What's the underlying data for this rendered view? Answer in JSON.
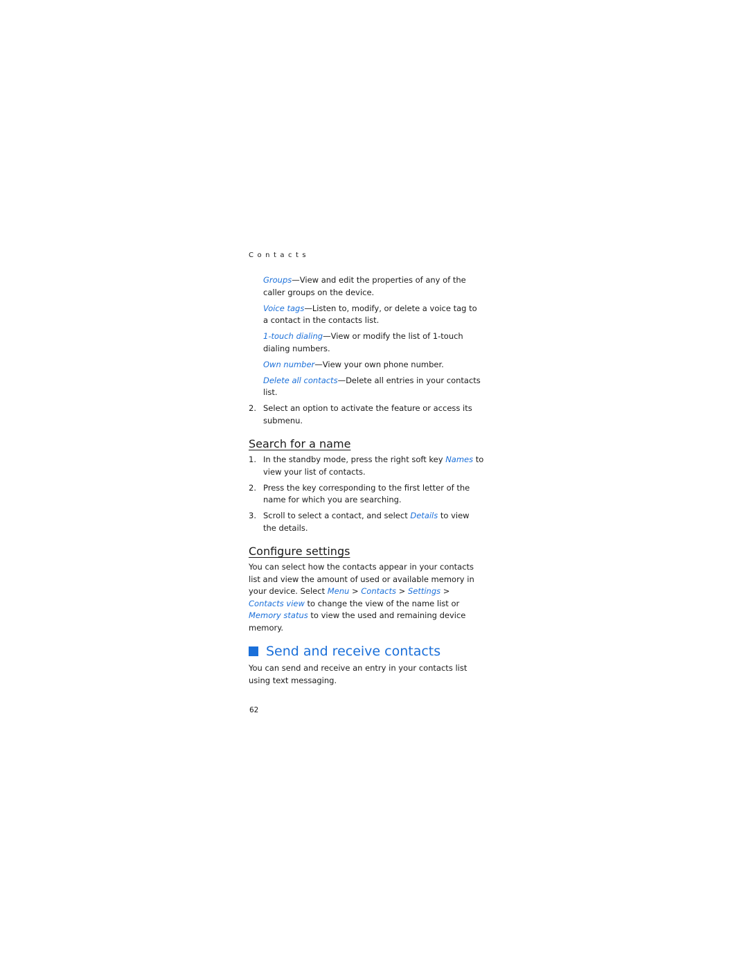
{
  "header": {
    "running_title": "Contacts"
  },
  "options": [
    {
      "term": "Groups",
      "desc": "—View and edit the properties of any of the caller groups on the device."
    },
    {
      "term": "Voice tags",
      "desc": "—Listen to, modify, or delete a voice tag to a contact in the contacts list."
    },
    {
      "term": "1-touch dialing",
      "desc": "—View or modify the list of 1-touch dialing numbers."
    },
    {
      "term": "Own number",
      "desc": "—View your own phone number."
    },
    {
      "term": "Delete all contacts",
      "desc": "—Delete all entries in your contacts list."
    }
  ],
  "step2": {
    "num": "2.",
    "text": "Select an option to activate the feature or access its submenu."
  },
  "search": {
    "heading": "Search for a name",
    "steps": [
      {
        "num": "1.",
        "pre": "In the standby mode, press the right soft key ",
        "link": "Names",
        "post": " to view your list of contacts."
      },
      {
        "num": "2.",
        "pre": "Press the key corresponding to the first letter of the name for which you are searching.",
        "link": "",
        "post": ""
      },
      {
        "num": "3.",
        "pre": "Scroll to select a contact, and select ",
        "link": "Details",
        "post": " to view the details."
      }
    ]
  },
  "configure": {
    "heading": "Configure settings",
    "text1": "You can select how the contacts appear in your contacts list and view the amount of used or available memory in your device. Select ",
    "menu": "Menu",
    "sep": " > ",
    "contacts": "Contacts",
    "settings": "Settings",
    "contacts_view": "Contacts view",
    "text2": " to change the view of the name list or ",
    "memory_status": "Memory status",
    "text3": " to view the used and remaining device memory."
  },
  "send_receive": {
    "heading": "Send and receive contacts",
    "text": "You can send and receive an entry in your contacts list using text messaging."
  },
  "footer": {
    "page_number": "62"
  },
  "colors": {
    "accent": "#1a6fd9",
    "text": "#1a1a1a"
  }
}
